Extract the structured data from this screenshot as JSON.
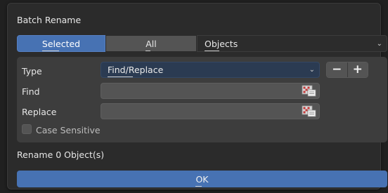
{
  "dialog": {
    "title": "Batch Rename",
    "data_source_tabs": [
      {
        "label": "Selected"
      },
      {
        "label": "All"
      }
    ],
    "data_type": {
      "value": "Objects",
      "icon": "chevron-down-icon"
    },
    "type_row": {
      "label": "Type",
      "value": "Find/Replace",
      "icon": "chevron-down-icon"
    },
    "find_row": {
      "label": "Find",
      "value": ""
    },
    "replace_row": {
      "label": "Replace",
      "value": ""
    },
    "case_sensitive": {
      "label": "Case Sensitive",
      "checked": false
    },
    "status": "Rename 0 Object(s)",
    "ok_label": "OK",
    "minus_label": "−",
    "plus_label": "+"
  },
  "colors": {
    "accent": "#4772b3",
    "panel": "#3d3d3d",
    "background": "#2b2b2b",
    "field": "#545454"
  }
}
